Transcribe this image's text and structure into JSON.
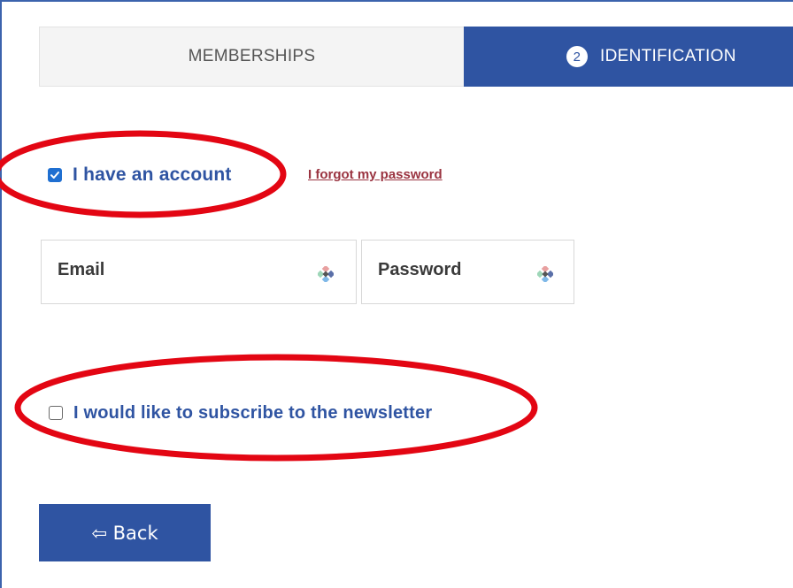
{
  "steps": {
    "memberships_label": "MEMBERSHIPS",
    "identification_number": "2",
    "identification_label": "IDENTIFICATION"
  },
  "account": {
    "checkbox_checked": true,
    "label": "I have an account",
    "forgot_link": "I forgot my password"
  },
  "email_field": {
    "placeholder": "Email",
    "icon": "keyboard-helper-icon"
  },
  "password_field": {
    "placeholder": "Password",
    "icon": "keyboard-helper-icon"
  },
  "newsletter": {
    "checkbox_checked": false,
    "label": "I would like to subscribe to the newsletter"
  },
  "back_button": {
    "label": "⇦ Back"
  },
  "colors": {
    "primary": "#2f54a2",
    "link": "#9a3340",
    "annotation": "#e30613",
    "tab_inactive_bg": "#f4f4f4"
  }
}
